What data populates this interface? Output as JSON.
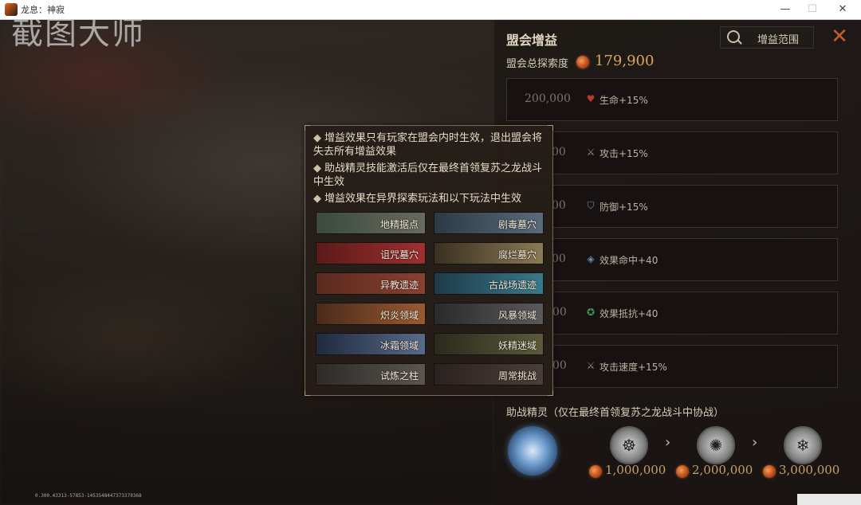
{
  "window": {
    "title": "龙息：神寂",
    "minimize": "—",
    "maximize": "☐",
    "close": "✕"
  },
  "watermark": "截图大师",
  "debug_text": "0.300.43313-57853-1453548447373370368",
  "panel": {
    "title": "盟会增益",
    "search_label": "增益范围",
    "close_icon": "✕",
    "total_label": "盟会总探索度",
    "total_value": "179,900",
    "tiers": [
      {
        "score": "200,000",
        "icon": "heart-icon",
        "glyph": "♥",
        "color": "#b83a2e",
        "text": "生命+15%"
      },
      {
        "score": "00",
        "icon": "sword-icon",
        "glyph": "⚔",
        "color": "#9a8f80",
        "text": "攻击+15%"
      },
      {
        "score": "00",
        "icon": "shield-icon",
        "glyph": "⛉",
        "color": "#6f8aa8",
        "text": "防御+15%"
      },
      {
        "score": "00",
        "icon": "target-icon",
        "glyph": "◈",
        "color": "#6f8aa8",
        "text": "效果命中+40"
      },
      {
        "score": "000",
        "icon": "resist-icon",
        "glyph": "✪",
        "color": "#4a9a5a",
        "text": "效果抵抗+40"
      },
      {
        "score": "000",
        "icon": "speed-sword-icon",
        "glyph": "⚔",
        "color": "#9a8f80",
        "text": "攻击速度+15%"
      }
    ],
    "helper_title": "助战精灵（仅在最终首领复苏之龙战斗中协战）",
    "emblems": [
      "☸",
      "✺",
      "❄"
    ],
    "arrow": "›",
    "costs": [
      "1,000,000",
      "2,000,000",
      "3,000,000"
    ]
  },
  "tooltip": {
    "notes": [
      "增益效果只有玩家在盟会内时生效，退出盟会将失去所有增益效果",
      "助战精灵技能激活后仅在最终首领复苏之龙战斗中生效",
      "增益效果在异界探索玩法和以下玩法中生效"
    ],
    "bullet": "◆",
    "modes": [
      {
        "label": "地精据点",
        "colors": [
          "#3a4a3e",
          "#6a6a5e"
        ]
      },
      {
        "label": "剧毒墓穴",
        "colors": [
          "#2a3a45",
          "#5a6a7a"
        ]
      },
      {
        "label": "诅咒墓穴",
        "colors": [
          "#5a1a18",
          "#a03030"
        ]
      },
      {
        "label": "腐烂墓穴",
        "colors": [
          "#3a3020",
          "#8a7a55"
        ]
      },
      {
        "label": "异教遗迹",
        "colors": [
          "#5a2a1e",
          "#8a4030"
        ]
      },
      {
        "label": "古战场遗迹",
        "colors": [
          "#1e3a4a",
          "#3a7a8a"
        ]
      },
      {
        "label": "炽炎领域",
        "colors": [
          "#4a2a1a",
          "#9a5a30"
        ]
      },
      {
        "label": "风暴领域",
        "colors": [
          "#2a2a2a",
          "#5a5a5a"
        ]
      },
      {
        "label": "冰霜领域",
        "colors": [
          "#1e2a3e",
          "#5a6a8a"
        ]
      },
      {
        "label": "妖精迷域",
        "colors": [
          "#2a2a1e",
          "#5a5a3a"
        ]
      },
      {
        "label": "试炼之柱",
        "colors": [
          "#2e2a28",
          "#5a5550"
        ]
      },
      {
        "label": "周常挑战",
        "colors": [
          "#2a2220",
          "#4a3e38"
        ]
      }
    ]
  }
}
